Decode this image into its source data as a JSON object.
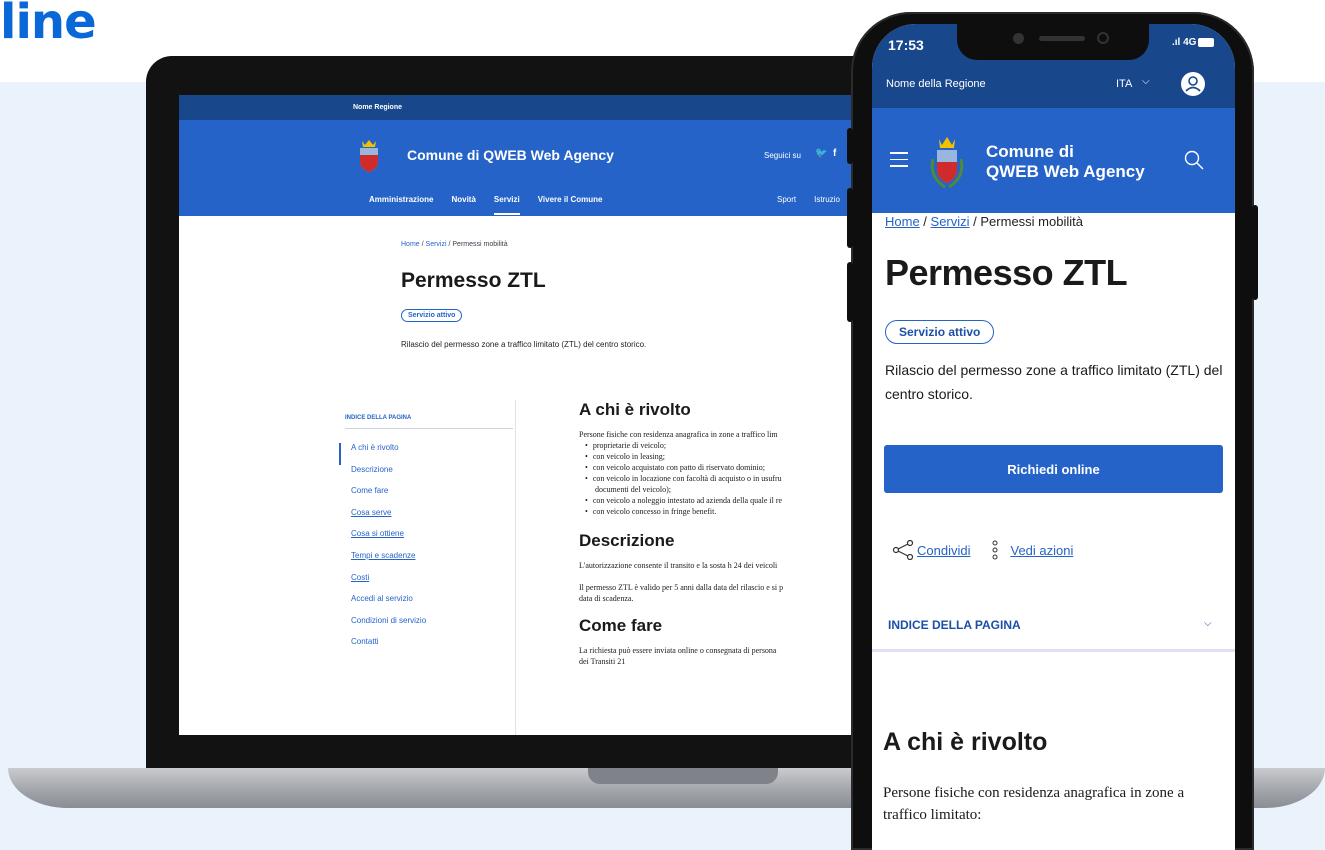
{
  "hero": {
    "title": "line"
  },
  "laptop": {
    "region": "Nome Regione",
    "brand": "Comune di QWEB Web Agency",
    "follow": "Seguici su",
    "nav": [
      "Amministrazione",
      "Novità",
      "Servizi",
      "Vivere il Comune"
    ],
    "nav_right": [
      "Sport",
      "Istruzio"
    ],
    "breadcrumb": [
      "Home",
      "Servizi",
      "Permessi mobilità"
    ],
    "title": "Permesso ZTL",
    "badge": "Servizio attivo",
    "subtitle": "Rilascio del permesso zone a traffico limitato (ZTL) del centro storico.",
    "index_label": "INDICE DELLA PAGINA",
    "index": [
      "A chi è rivolto",
      "Descrizione",
      "Come fare",
      "Cosa serve",
      "Cosa si ottiene",
      "Tempi e scadenze",
      "Costi",
      "Accedi al servizio",
      "Condizioni di servizio",
      "Contatti"
    ],
    "sections": {
      "who_title": "A chi è rivolto",
      "who_intro": "Persone fisiche con residenza anagrafica in zone a traffico lim",
      "who_items": [
        "proprietarie di veicolo;",
        "con veicolo in leasing;",
        "con veicolo acquistato con patto di riservato dominio;",
        "con veicolo in locazione con facoltà di acquisto o in usufru",
        "documenti del veicolo);",
        "con veicolo a noleggio intestato ad azienda della quale il re",
        "con veicolo concesso in fringe benefit."
      ],
      "desc_title": "Descrizione",
      "desc_p1": "L'autorizzazione consente il transito e la sosta h 24 dei veicoli",
      "desc_p2a": "Il permesso ZTL è valido per 5 anni dalla data del rilascio e si p",
      "desc_p2b": "data di scadenza.",
      "how_title": "Come fare",
      "how_p1": "La richiesta può essere inviata online o consegnata di persona",
      "how_p2": "dei Transiti 21"
    }
  },
  "phone": {
    "time": "17:53",
    "network": "4G",
    "region": "Nome della Regione",
    "lang": "ITA",
    "brand_line1": "Comune di",
    "brand_line2": "QWEB Web Agency",
    "breadcrumb": [
      "Home",
      "Servizi",
      "Permessi mobilità"
    ],
    "title": "Permesso ZTL",
    "badge": "Servizio attivo",
    "description": "Rilascio del permesso zone a traffico limitato (ZTL) del centro storico.",
    "cta": "Richiedi online",
    "share": "Condividi",
    "actions": "Vedi azioni",
    "index_label": "INDICE DELLA PAGINA",
    "section_title": "A chi è rivolto",
    "section_body": "Persone fisiche con residenza anagrafica in zone a traffico limitato:"
  },
  "colors": {
    "primary": "#2563c9",
    "dark_blue": "#18478c",
    "hero": "#0a67d8",
    "backdrop": "#eaf3fc"
  }
}
